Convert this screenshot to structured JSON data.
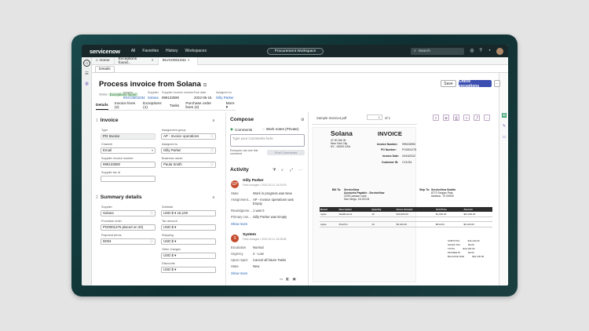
{
  "topnav": {
    "logo": "servicenow",
    "menu": [
      "All",
      "Favorites",
      "History",
      "Workspaces"
    ],
    "workspace_label": "Procurement Workspace",
    "search_placeholder": "Search"
  },
  "tabs": [
    {
      "label": "Home"
    },
    {
      "label": "Exceptions found..."
    },
    {
      "label": "INVC0001034"
    }
  ],
  "subtab": "Details",
  "record": {
    "title": "Process invoice from Solana",
    "meta": [
      {
        "label": "Status",
        "value": "Exceptions found"
      },
      {
        "label": "Invoice",
        "value": "INVC0001034"
      },
      {
        "label": "Supplier",
        "value": "Solana"
      },
      {
        "label": "Supplier invoice number",
        "value": "999133590"
      },
      {
        "label": "Due date",
        "value": "2022-05-15"
      },
      {
        "label": "Assigned to",
        "value": "Gilly Parker"
      }
    ],
    "buttons": {
      "save": "Save",
      "check": "Check exceptions",
      "more": "⋯"
    },
    "form_tabs": [
      "Details",
      "Invoice lines (2)",
      "Exceptions (1)",
      "Tasks",
      "Purchase order lines (2)",
      "More ▾"
    ]
  },
  "invoice_section": {
    "number": "1",
    "heading": "Invoice",
    "fields": {
      "type": {
        "label": "Type",
        "value": "PO Invoice"
      },
      "channel": {
        "label": "Channel",
        "value": "Email"
      },
      "supplier_invoice_number": {
        "label": "Supplier invoice number",
        "value": "999133590"
      },
      "supplier_tax_id": {
        "label": "Supplier tax id",
        "value": ""
      },
      "assignment_group": {
        "label": "Assignment group",
        "value": "AP - Invoice operations"
      },
      "assigned_to": {
        "label": "Assigned to",
        "value": "Gilly Parker"
      },
      "business_owner": {
        "label": "Business owner",
        "value": "Paula Smith"
      }
    }
  },
  "summary_section": {
    "number": "2",
    "heading": "Summary details",
    "fields": {
      "supplier": {
        "label": "Supplier",
        "value": "Solana"
      },
      "purchase_order": {
        "label": "Purchase order",
        "value": "PO0001275 placed on 20("
      },
      "payment_terms": {
        "label": "Payment terms",
        "value": "D004"
      },
      "subtotal": {
        "label": "Subtotal",
        "value": "USD $ ▾ 16,100"
      },
      "tax_amount": {
        "label": "Tax amount",
        "value": "USD $ ▾"
      },
      "shipping": {
        "label": "Shipping",
        "value": "USD $ ▾"
      },
      "other_charges": {
        "label": "Other charges",
        "value": "USD $ ▾"
      },
      "discounts": {
        "label": "Discounts",
        "value": "USD $ ▾"
      }
    }
  },
  "compose": {
    "heading": "Compose",
    "tab_comments": "Comments",
    "tab_work_notes": "Work notes (Private)",
    "placeholder": "Type your Comments here",
    "visibility_note": "Everyone can see this comment",
    "post_button": "Post Comments"
  },
  "activity": {
    "heading": "Activity",
    "entries": [
      {
        "avatar": "GP",
        "name": "Gilly Parker",
        "sub": "Field changes • 2022-02-11 10:29:29",
        "rows": [
          {
            "label": "State",
            "value": "Work in progress was New"
          },
          {
            "label": "Assignment...",
            "value": "AP - Invoice operations was Empty"
          },
          {
            "label": "Reassignme...",
            "value": "1 was 0"
          },
          {
            "label": "Primary con...",
            "value": "Gilly Parker was Empty"
          }
        ],
        "more": "Show more"
      },
      {
        "avatar": "S",
        "name": "System",
        "sub": "Field changes • 2022-02-11 10:06:08",
        "rows": [
          {
            "label": "Escalation",
            "value": "Normal"
          },
          {
            "label": "Urgency",
            "value": "2 - Low"
          },
          {
            "label": "Upon reject",
            "value": "Cancel all future Tasks"
          },
          {
            "label": "State",
            "value": "New"
          }
        ],
        "more": "Show more"
      }
    ]
  },
  "pdf": {
    "filename": "Sample-Invoice4.pdf",
    "page_current": "1",
    "page_total": "of 1",
    "vendor_name": "Solana",
    "vendor_address": [
      "47 W 11th St",
      "New York City",
      "NY - 00000 USA"
    ],
    "doc_title": "INVOICE",
    "info": [
      {
        "label": "Invoice Number:",
        "value": "999133590"
      },
      {
        "label": "PO Number:",
        "value": "PO0001275"
      },
      {
        "label": "Invoice Date:",
        "value": "04/16/2022"
      },
      {
        "label": "Customer ID:",
        "value": "CX1234"
      }
    ],
    "bill_to_label": "Bill To:",
    "bill_to": [
      "ServiceNow",
      "Accounts Payable - ServiceNow",
      "2225 Lawson Lane",
      "San Diego, CA 92131"
    ],
    "ship_to_label": "Ship To:",
    "ship_to": [
      "ServiceNow Seattle",
      "8770 Scripps Park",
      "Addison, TX 00000"
    ],
    "table_headers": [
      "Brand",
      "Description",
      "Quantity",
      "Gross Amount",
      "Unit Price",
      "Amount"
    ],
    "table_rows": [
      [
        "Apple",
        "MacBook Air",
        "10",
        "$10,000.00",
        "$1,000.00",
        "$10,000.00"
      ],
      [
        "Apple",
        "iPad Pro",
        "10",
        "$6,100.00",
        "$610.00",
        "$6,100.00"
      ]
    ],
    "totals": [
      {
        "label": "SUBTOTAL",
        "value": "$16,100.00"
      },
      {
        "label": "SALES TAX",
        "value": "$0.00"
      },
      {
        "label": "TOTAL",
        "value": "$16,100.00"
      },
      {
        "label": "PAYMENTS",
        "value": "$0.00"
      },
      {
        "label": "BALANCE DUE",
        "value": "$16,100.00"
      }
    ]
  }
}
